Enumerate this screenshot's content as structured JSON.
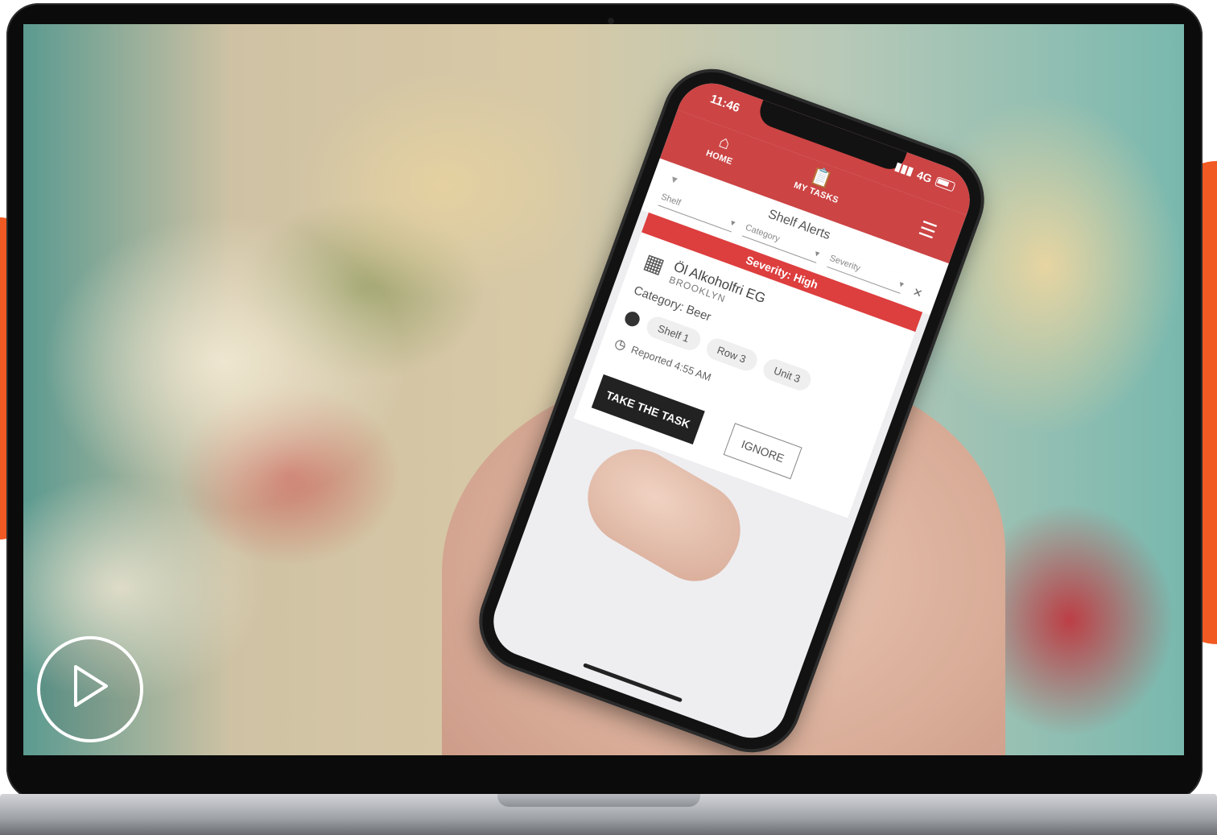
{
  "phone": {
    "time": "11:46",
    "network": "4G",
    "nav": {
      "home_label": "HOME",
      "my_tasks_label": "MY TASKS"
    },
    "title": "Shelf Alerts",
    "filters": [
      "Shelf",
      "Category",
      "Severity"
    ],
    "alert": {
      "severity": "Severity: High",
      "product_name": "Öl Alkoholfri EG",
      "brand": "BROOKLYN",
      "category": "Category: Beer",
      "locations": [
        "Shelf 1",
        "Row 3",
        "Unit 3"
      ],
      "reported": "Reported 4:55 AM",
      "take_label": "TAKE THE TASK",
      "ignore_label": "IGNORE"
    }
  },
  "icons": [
    "home-icon",
    "clipboard-icon",
    "menu-icon",
    "filter-icon",
    "close-icon",
    "store-icon",
    "location-pin-icon",
    "clock-icon",
    "play-icon"
  ],
  "colors": {
    "accent": "#f15a22",
    "app_red": "#cc4444",
    "severity_red": "#dd3e3e"
  }
}
